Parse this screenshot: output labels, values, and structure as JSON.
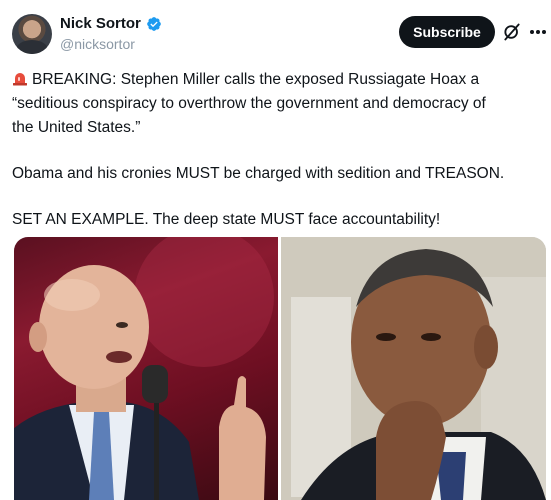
{
  "author": {
    "display_name": "Nick Sortor",
    "handle": "@nicksortor",
    "verified": true,
    "avatar_icon": "avatar"
  },
  "actions": {
    "subscribe_label": "Subscribe",
    "grok_icon": "grok-icon",
    "more_icon": "more-icon"
  },
  "post": {
    "line1_emoji": "rotating-light-icon",
    "line1": "BREAKING: Stephen Miller calls the exposed Russiagate Hoax a",
    "line2": "“seditious conspiracy to overthrow the government and democracy of",
    "line3": "the United States.”",
    "paragraph2": "Obama and his cronies MUST be charged with sedition and TREASON.",
    "paragraph3": "SET AN EXAMPLE. The deep state MUST face accountability!"
  },
  "media": {
    "images": [
      "left-photo-speaker-at-microphone",
      "right-photo-man-thinking"
    ]
  },
  "colors": {
    "subscribe_bg": "#0f1419",
    "verified_blue": "#1d9bf0",
    "handle_gray": "#8b98a5"
  }
}
